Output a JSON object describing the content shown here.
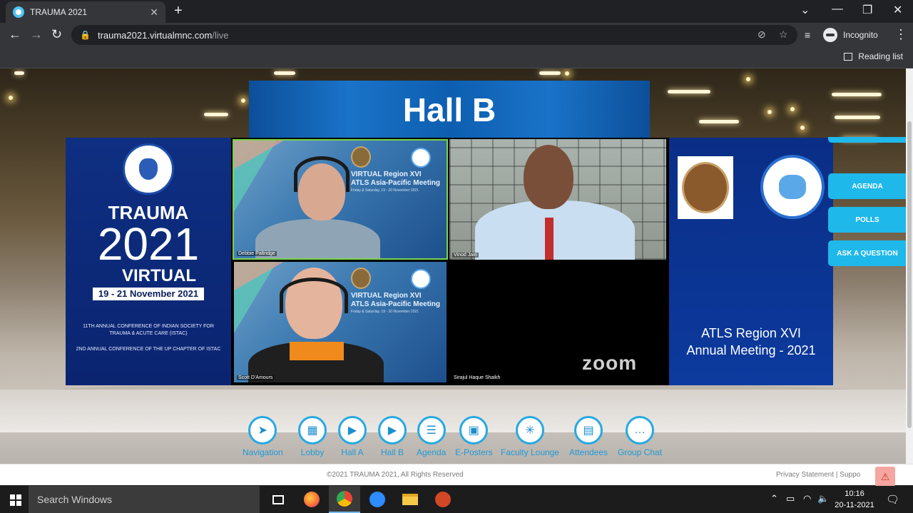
{
  "browser": {
    "tab_title": "TRAUMA 2021",
    "url_host": "trauma2021.virtualmnc.com",
    "url_path": "/live",
    "profile_label": "Incognito",
    "reading_list_label": "Reading list"
  },
  "hall": {
    "title": "Hall B"
  },
  "left_panel": {
    "trauma": "TRAUMA",
    "year": "2021",
    "virtual": "VIRTUAL",
    "dates": "19 - 21 November 2021",
    "conference_line1": "11TH ANNUAL CONFERENCE OF INDIAN SOCIETY FOR TRAUMA & ACUTE CARE (ISTAC)",
    "conference_line2": "2ND ANNUAL CONFERENCE OF THE UP CHAPTER OF ISTAC"
  },
  "right_panel": {
    "title_line1": "ATLS Region XVI",
    "title_line2": "Annual Meeting - 2021"
  },
  "zoom": {
    "slide_line1": "VIRTUAL Region XVI",
    "slide_line2": "ATLS Asia-Pacific Meeting",
    "slide_line3": "Friday & Saturday, 19 - 20 November 2021",
    "participants": [
      {
        "name": "Debbie Paltridge"
      },
      {
        "name": "Vinod Jain"
      },
      {
        "name": "Scott D'Amours"
      },
      {
        "name": "Sirajul Haque Shaikh"
      }
    ],
    "logo": "zoom"
  },
  "side_buttons": [
    "AGENDA",
    "POLLS",
    "ASK A QUESTION"
  ],
  "bottom_nav": [
    {
      "label": "Navigation",
      "icon": "navigation-arrow-icon"
    },
    {
      "label": "Lobby",
      "icon": "reception-desk-icon"
    },
    {
      "label": "Hall A",
      "icon": "video-play-icon"
    },
    {
      "label": "Hall B",
      "icon": "video-play-icon"
    },
    {
      "label": "Agenda",
      "icon": "clipboard-list-icon"
    },
    {
      "label": "E-Posters",
      "icon": "poster-board-icon"
    },
    {
      "label": "Faculty Lounge",
      "icon": "network-icon"
    },
    {
      "label": "Attendees",
      "icon": "id-badge-icon"
    },
    {
      "label": "Group Chat",
      "icon": "chat-bubble-icon"
    }
  ],
  "footer": {
    "copyright": "©2021 TRAUMA 2021, All Rights Reserved",
    "links": "Privacy Statement | Suppo"
  },
  "taskbar": {
    "search_placeholder": "Search Windows",
    "time": "10:16",
    "date": "20-11-2021"
  }
}
